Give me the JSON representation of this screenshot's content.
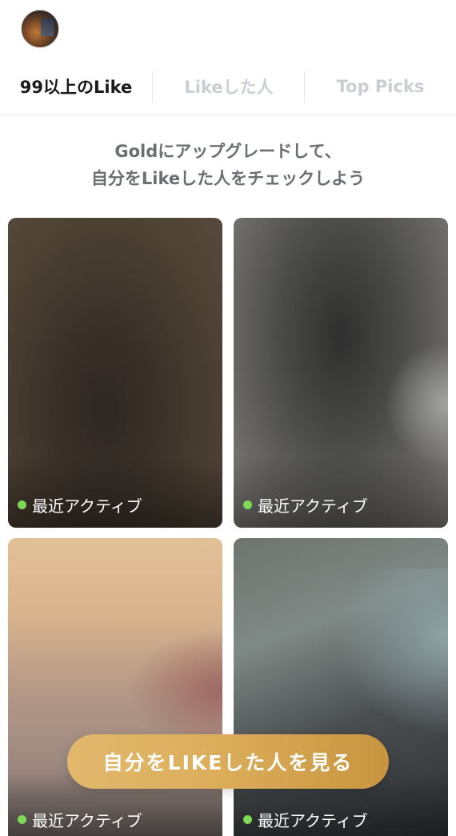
{
  "header": {
    "avatar_icon": "profile-avatar"
  },
  "tabs": [
    {
      "label": "99以上のLike",
      "active": true
    },
    {
      "label": "Likeした人",
      "active": false
    },
    {
      "label": "Top Picks",
      "active": false
    }
  ],
  "promo": {
    "line1": "Goldにアップグレードして、",
    "line2": "自分をLikeした人をチェックしよう"
  },
  "cards": [
    {
      "status": "最近アクティブ"
    },
    {
      "status": "最近アクティブ"
    },
    {
      "status": "最近アクティブ"
    },
    {
      "status": "最近アクティブ"
    }
  ],
  "cta": {
    "label": "自分をLIKEした人を見る"
  },
  "colors": {
    "active_dot": "#7ed957",
    "gold_start": "#e2b86c",
    "gold_end": "#c8953f",
    "inactive_tab": "#c9ced4"
  }
}
